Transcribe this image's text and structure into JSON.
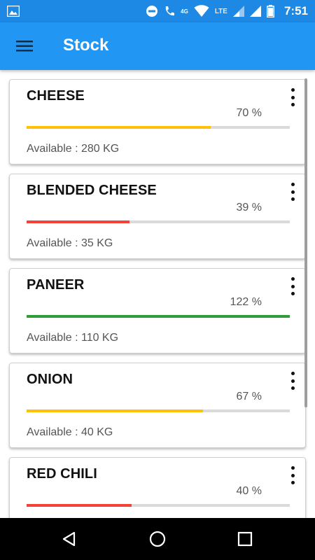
{
  "status_bar": {
    "time": "7:51",
    "network": "LTE",
    "data_type": "4G",
    "icons": [
      "image-icon",
      "do-not-disturb-icon",
      "call-icon",
      "wifi-icon",
      "signal-icon",
      "signal-icon",
      "battery-icon"
    ]
  },
  "app_bar": {
    "title": "Stock",
    "menu_icon": "hamburger-menu-icon",
    "color": "#2196f3"
  },
  "stock_items": [
    {
      "name": "CHEESE",
      "percent_label": "70 %",
      "percent": 70,
      "available": "Available : 280 KG",
      "bar_color": "#ffc107"
    },
    {
      "name": "BLENDED CHEESE",
      "percent_label": "39 %",
      "percent": 39,
      "available": "Available : 35 KG",
      "bar_color": "#f44336"
    },
    {
      "name": "PANEER",
      "percent_label": "122 %",
      "percent": 100,
      "available": "Available : 110 KG",
      "bar_color": "#2e9e3a"
    },
    {
      "name": "ONION",
      "percent_label": "67 %",
      "percent": 67,
      "available": "Available : 40 KG",
      "bar_color": "#ffc107"
    },
    {
      "name": "RED CHILI",
      "percent_label": "40 %",
      "percent": 40,
      "available": "",
      "bar_color": "#f44336"
    }
  ],
  "nav_bar": {
    "icons": [
      "back-icon",
      "home-icon",
      "recents-icon"
    ]
  }
}
